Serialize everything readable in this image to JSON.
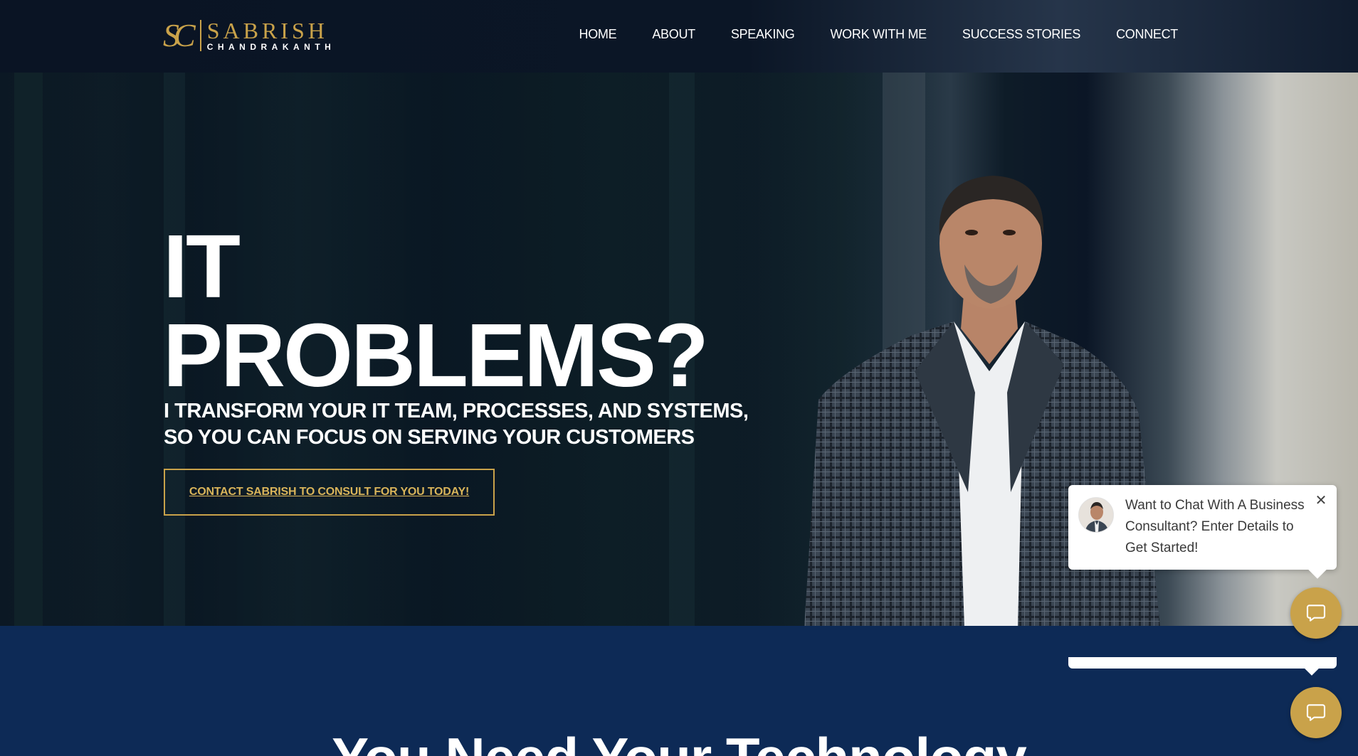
{
  "header": {
    "logo": {
      "mark": "SC",
      "name": "SABRISH",
      "sub": "CHANDRAKANTH"
    },
    "nav": [
      "HOME",
      "ABOUT",
      "SPEAKING",
      "WORK WITH ME",
      "SUCCESS STORIES",
      "CONNECT"
    ]
  },
  "hero": {
    "title_line1": "IT",
    "title_line2": "PROBLEMS?",
    "subtitle_line1": "I TRANSFORM YOUR IT TEAM, PROCESSES, AND SYSTEMS,",
    "subtitle_line2": "SO YOU CAN FOCUS ON SERVING YOUR CUSTOMERS",
    "cta_label": "CONTACT SABRISH TO CONSULT FOR YOU TODAY!"
  },
  "section2": {
    "title": "You Need Your Technology"
  },
  "chat": {
    "message": "Want to Chat With A Business Consultant? Enter Details to Get Started!",
    "close_icon": "close-icon",
    "button_icon": "chat-bubble-icon"
  },
  "colors": {
    "navy": "#0a1424",
    "gold": "#c9a24a",
    "section_blue": "#0d2a56",
    "white": "#ffffff"
  }
}
